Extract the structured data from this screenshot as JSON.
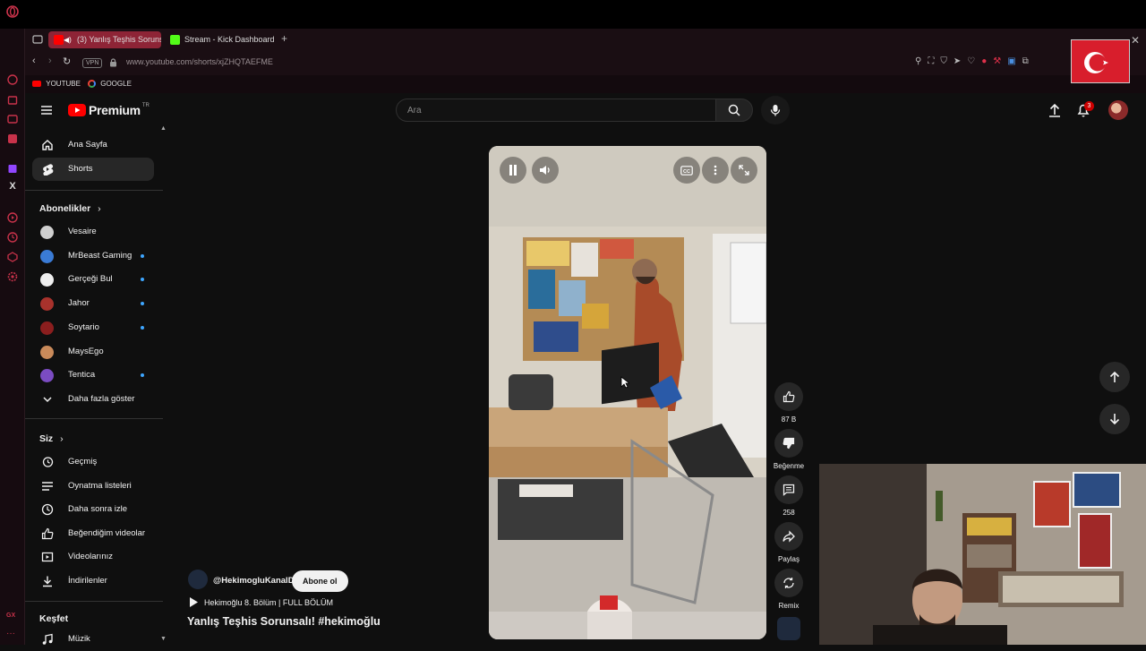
{
  "browser": {
    "tabs": [
      {
        "label": "(3) Yanlış Teşhis Sorunsalı! #hekimoğlu",
        "active": true
      },
      {
        "label": "Stream - Kick Dashboard",
        "active": false
      }
    ],
    "vpn_label": "VPN",
    "url": "www.youtube.com/shorts/xjZHQTAEFME",
    "bookmarks": [
      "YOUTUBE",
      "GOOGLE"
    ]
  },
  "youtube": {
    "logo_text": "Premium",
    "logo_region": "TR",
    "search_placeholder": "Ara",
    "notification_count": "3",
    "sidebar": {
      "main": [
        {
          "label": "Ana Sayfa",
          "icon": "home-icon"
        },
        {
          "label": "Shorts",
          "icon": "shorts-icon",
          "active": true
        }
      ],
      "subscriptions_title": "Abonelikler",
      "subscriptions": [
        {
          "label": "Vesaire",
          "color": "#cfcfcf",
          "new": false
        },
        {
          "label": "MrBeast Gaming",
          "color": "#3a7bd5",
          "new": true
        },
        {
          "label": "Gerçeği Bul",
          "color": "#eeeeee",
          "new": true
        },
        {
          "label": "Jahor",
          "color": "#a8322c",
          "new": true
        },
        {
          "label": "Soytario",
          "color": "#8b1e1e",
          "new": true
        },
        {
          "label": "MaysEgo",
          "color": "#c98a5a",
          "new": false
        },
        {
          "label": "Tentica",
          "color": "#7b4cc2",
          "new": true
        }
      ],
      "show_more": "Daha fazla göster",
      "you_title": "Siz",
      "you_items": [
        {
          "label": "Geçmiş",
          "icon": "history-icon"
        },
        {
          "label": "Oynatma listeleri",
          "icon": "playlist-icon"
        },
        {
          "label": "Daha sonra izle",
          "icon": "clock-icon"
        },
        {
          "label": "Beğendiğim videolar",
          "icon": "like-icon"
        },
        {
          "label": "Videolarınız",
          "icon": "video-icon"
        },
        {
          "label": "İndirilenler",
          "icon": "download-icon"
        }
      ],
      "explore_title": "Keşfet",
      "explore_items": [
        {
          "label": "Müzik",
          "icon": "music-icon"
        }
      ]
    },
    "short": {
      "channel": "@HekimogluKanalD",
      "subscribe_label": "Abone ol",
      "playlist": "Hekimoğlu 8. Bölüm | FULL BÖLÜM",
      "title": "Yanlış Teşhis Sorunsalı! #hekimoğlu",
      "likes": "87 B",
      "dislike_label": "Beğenme",
      "comments": "258",
      "share_label": "Paylaş",
      "remix_label": "Remix"
    }
  },
  "colors": {
    "accent_red": "#ff0000",
    "opera_red": "#c8324a",
    "active_tab": "#8e2436"
  }
}
